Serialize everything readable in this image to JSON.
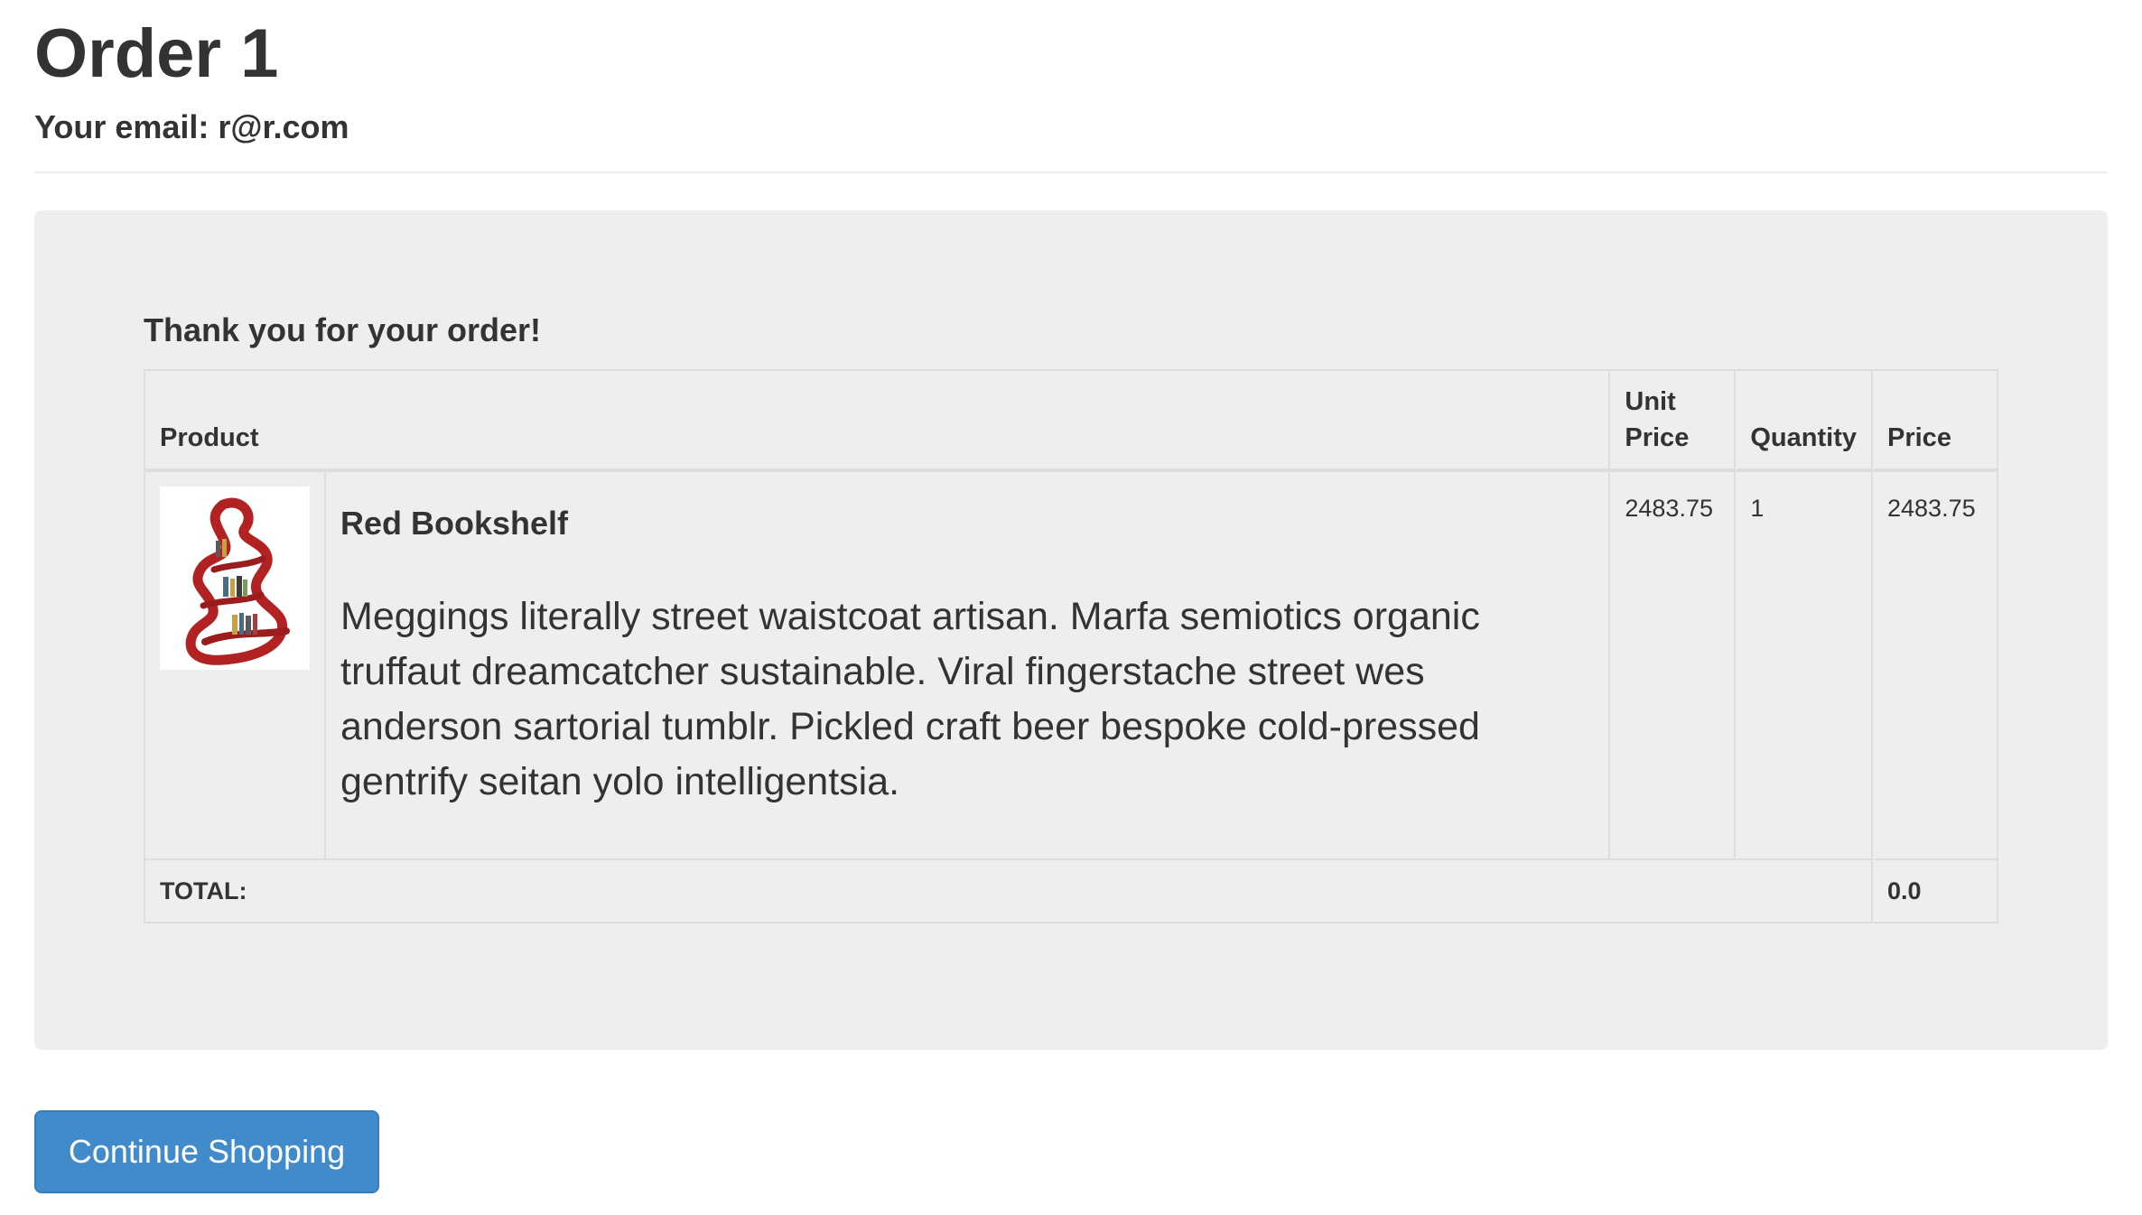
{
  "header": {
    "title": "Order 1",
    "email_line": "Your email: r@r.com"
  },
  "order": {
    "thank_you": "Thank you for your order!",
    "columns": {
      "product": "Product",
      "unit_price": "Unit Price",
      "quantity": "Quantity",
      "price": "Price"
    },
    "items": [
      {
        "name": "Red Bookshelf",
        "description": "Meggings literally street waistcoat artisan. Marfa semiotics organic truffaut dreamcatcher sustainable. Viral fingerstache street wes anderson sartorial tumblr. Pickled craft beer bespoke cold-pressed gentrify seitan yolo intelligentsia.",
        "unit_price": "2483.75",
        "quantity": "1",
        "price": "2483.75",
        "image_color": "#b22222"
      }
    ],
    "total_label": "TOTAL:",
    "total_value": "0.0"
  },
  "actions": {
    "continue_label": "Continue Shopping"
  },
  "colors": {
    "primary_button": "#428bca",
    "well_background": "#eeeeee",
    "text": "#333333"
  }
}
